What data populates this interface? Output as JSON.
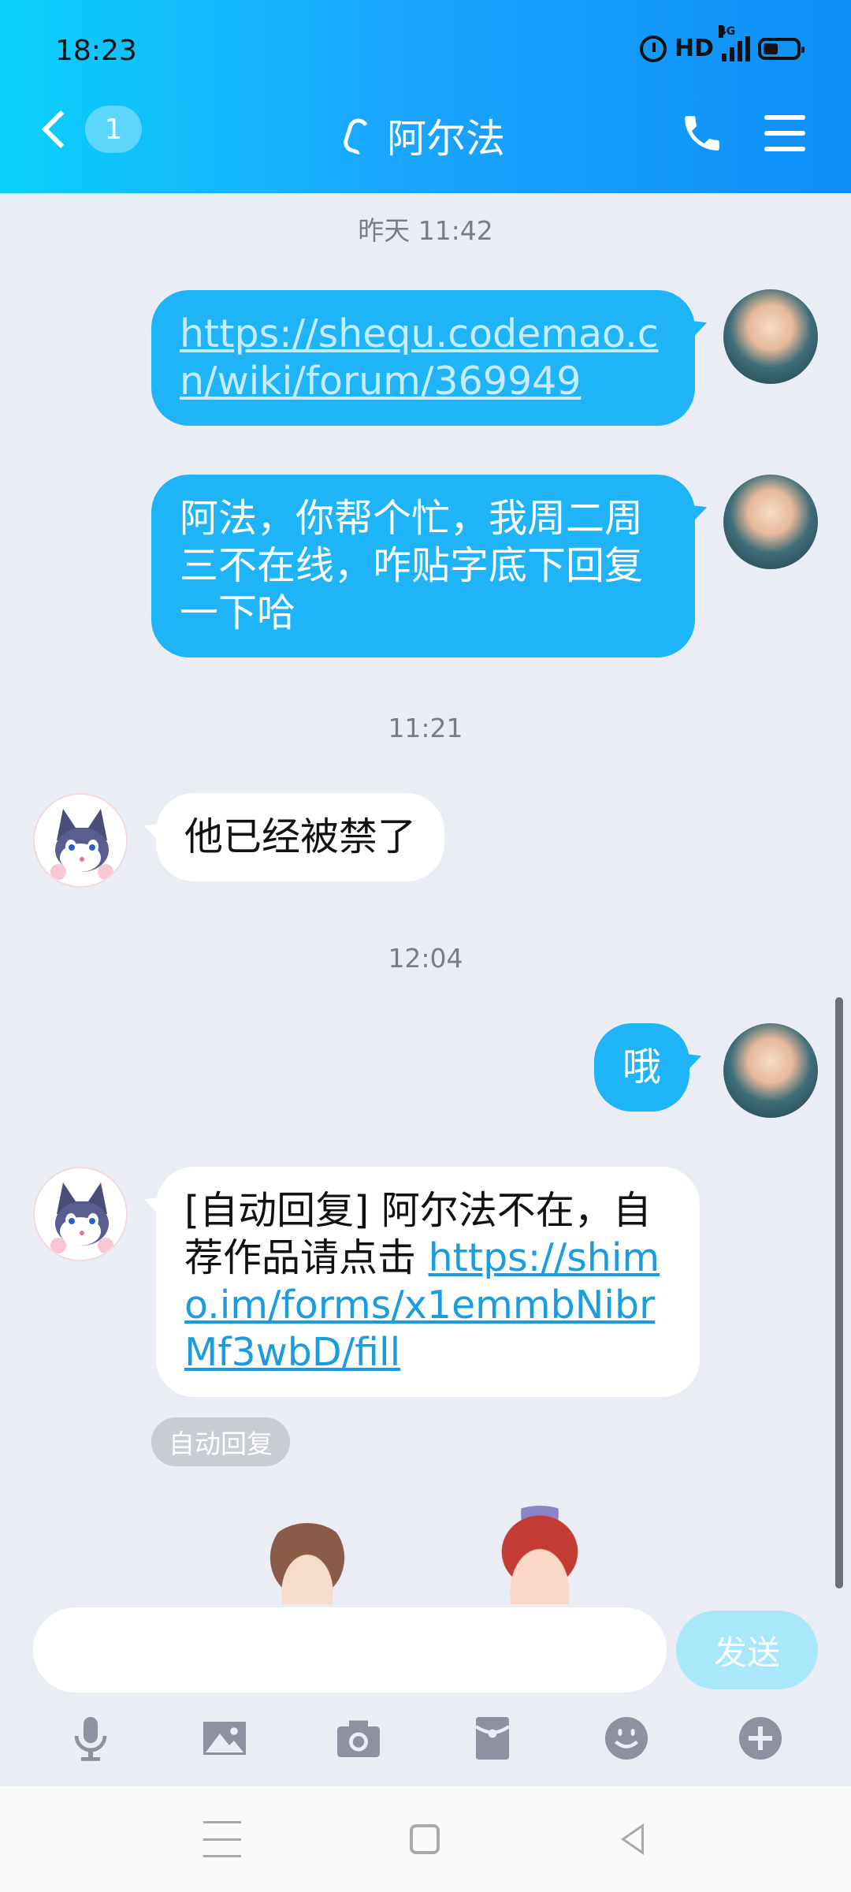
{
  "status_bar": {
    "time": "18:23",
    "hd": "HD",
    "network": "4G"
  },
  "header": {
    "unread_count": "1",
    "title": "阿尔法"
  },
  "messages": [
    {
      "timestamp": "昨天 11:42"
    },
    {
      "direction": "out",
      "link": "https://shequ.codemao.cn/wiki/forum/369949"
    },
    {
      "direction": "out",
      "text": "阿法，你帮个忙，我周二周三不在线，咋贴字底下回复一下哈"
    },
    {
      "timestamp": "11:21"
    },
    {
      "direction": "in",
      "text": "他已经被禁了"
    },
    {
      "timestamp": "12:04"
    },
    {
      "direction": "out",
      "text": "哦"
    },
    {
      "direction": "in",
      "text": "[自动回复] 阿尔法不在，自荐作品请点击",
      "link": "https://shimo.im/forms/x1emmbNibrMf3wbD/fill",
      "tag": "自动回复"
    }
  ],
  "input": {
    "placeholder": "",
    "send_label": "发送"
  },
  "toolbar": [
    "microphone-icon",
    "image-icon",
    "camera-icon",
    "red-packet-icon",
    "emoji-icon",
    "plus-icon"
  ],
  "colors": {
    "header_start": "#0ad0f8",
    "header_end": "#0e8ff7",
    "bubble_out": "#1fb4f7",
    "bubble_in": "#ffffff",
    "background": "#eaedf4"
  }
}
